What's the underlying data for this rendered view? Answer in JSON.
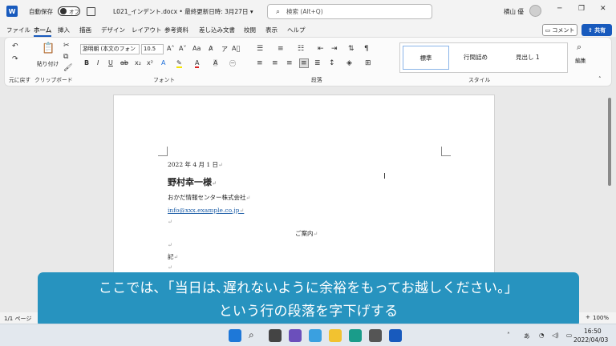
{
  "titlebar": {
    "autosave": "自動保存",
    "toggle": "オフ",
    "doc_title": "L021_インデント.docx • 最終更新日時: 3月27日 ▾",
    "search_placeholder": "検索 (Alt+Q)",
    "user": "横山 優",
    "logo": "W"
  },
  "menu": [
    "ファイル",
    "ホーム",
    "挿入",
    "描画",
    "デザイン",
    "レイアウト",
    "参考資料",
    "差し込み文書",
    "校閲",
    "表示",
    "ヘルプ"
  ],
  "buttons": {
    "comment": "コメント",
    "share": "共有"
  },
  "ribbon": {
    "undo_label": "元に戻す",
    "clipboard_label": "クリップボード",
    "paste_label": "貼り付け",
    "font_label": "フォント",
    "paragraph_label": "段落",
    "style_label": "スタイル",
    "edit_label": "編集",
    "font_name": "游明朝 (本文のフォン",
    "font_size": "10.5",
    "styles": [
      "標準",
      "行間詰め",
      "見出し 1"
    ]
  },
  "document": {
    "date": "2022 年 4 月 1 日",
    "recipient": "野村幸一様",
    "company": "おかだ情報センター株式会社",
    "email": "info@xxx.example.co.jp",
    "title": "ご案内",
    "ki": "記",
    "mark": "↵"
  },
  "caption": {
    "line1": "ここでは､「当日は､遅れないように余裕をもってお越しください｡」",
    "line2": "という行の段落を字下げする"
  },
  "status": {
    "page": "1/1 ページ",
    "zoom": "100%"
  },
  "taskbar": {
    "time": "16:50",
    "date": "2022/04/03",
    "ime": "あ"
  }
}
